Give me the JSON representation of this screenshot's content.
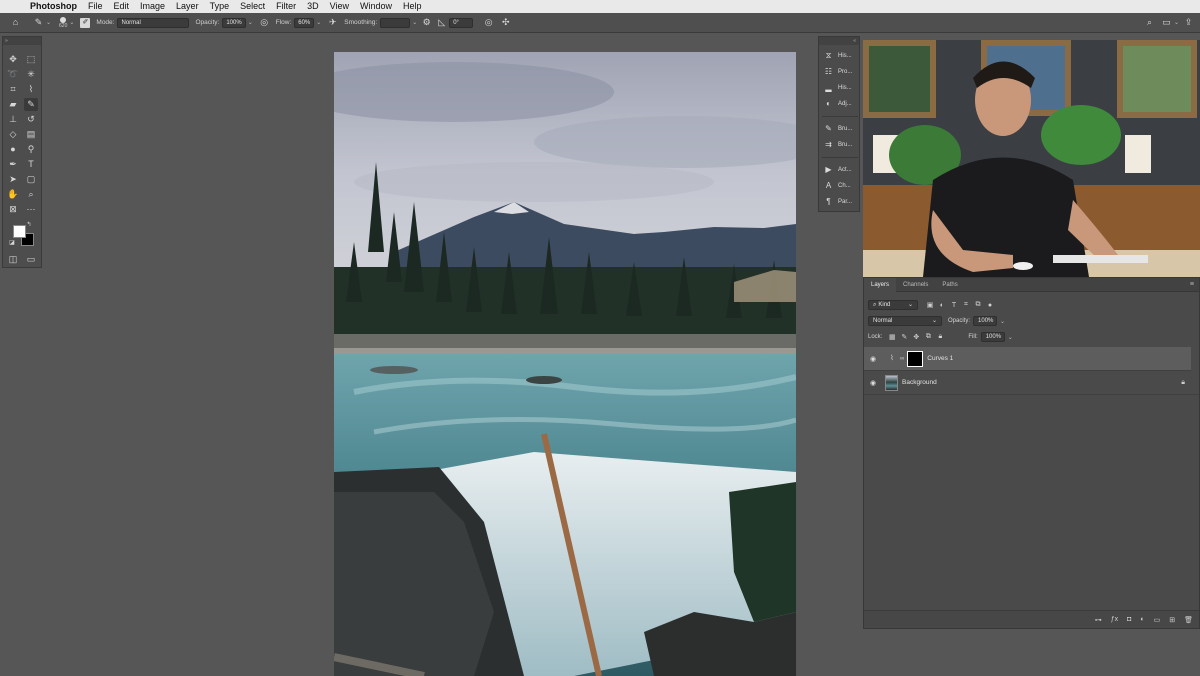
{
  "menubar": {
    "app": "Photoshop",
    "items": [
      "File",
      "Edit",
      "Image",
      "Layer",
      "Type",
      "Select",
      "Filter",
      "3D",
      "View",
      "Window",
      "Help"
    ]
  },
  "options": {
    "brush_size": "620",
    "mode_label": "Mode:",
    "mode_value": "Normal",
    "opacity_label": "Opacity:",
    "opacity_value": "100%",
    "flow_label": "Flow:",
    "flow_value": "60%",
    "smoothing_label": "Smoothing:",
    "smoothing_value": "",
    "angle_value": "0°"
  },
  "minipanel": {
    "items": [
      {
        "label": "His...",
        "icon": "history-icon"
      },
      {
        "label": "Pro...",
        "icon": "properties-icon"
      },
      {
        "label": "His...",
        "icon": "histogram-icon"
      },
      {
        "label": "Adj...",
        "icon": "adjustments-icon"
      },
      {
        "label": "Bru...",
        "icon": "brush-icon"
      },
      {
        "label": "Bru...",
        "icon": "brush-settings-icon"
      },
      {
        "label": "Act...",
        "icon": "actions-icon"
      },
      {
        "label": "Ch...",
        "icon": "character-icon"
      },
      {
        "label": "Par...",
        "icon": "paragraph-icon"
      }
    ]
  },
  "layers_panel": {
    "tabs": [
      "Layers",
      "Channels",
      "Paths"
    ],
    "active_tab": "Layers",
    "filter_kind": "Kind",
    "blend_mode": "Normal",
    "opacity_label": "Opacity:",
    "opacity_value": "100%",
    "lock_label": "Lock:",
    "fill_label": "Fill:",
    "fill_value": "100%",
    "layers": [
      {
        "name": "Curves 1",
        "selected": true
      },
      {
        "name": "Background",
        "selected": false
      }
    ]
  }
}
